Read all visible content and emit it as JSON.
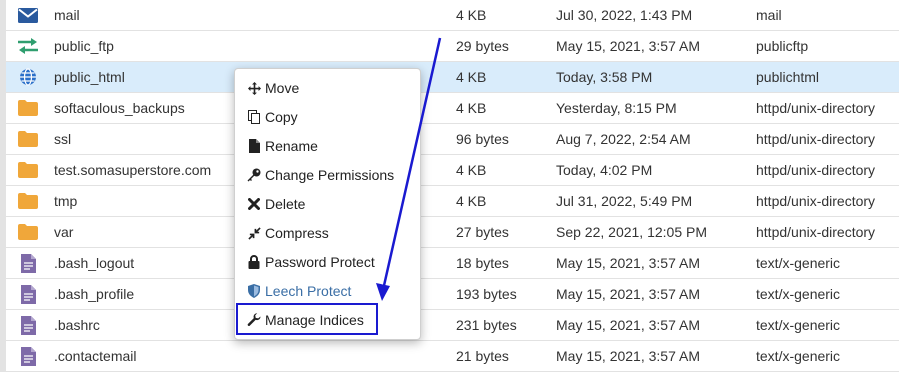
{
  "files": [
    {
      "icon": "mail-icon",
      "name": "mail",
      "size": "4 KB",
      "date": "Jul 30, 2022, 1:43 PM",
      "type": "mail",
      "selected": false
    },
    {
      "icon": "transfer-icon",
      "name": "public_ftp",
      "size": "29 bytes",
      "date": "May 15, 2021, 3:57 AM",
      "type": "publicftp",
      "selected": false
    },
    {
      "icon": "globe-icon",
      "name": "public_html",
      "size": "4 KB",
      "date": "Today, 3:58 PM",
      "type": "publichtml",
      "selected": true
    },
    {
      "icon": "folder-icon",
      "name": "softaculous_backups",
      "size": "4 KB",
      "date": "Yesterday, 8:15 PM",
      "type": "httpd/unix-directory",
      "selected": false
    },
    {
      "icon": "folder-icon",
      "name": "ssl",
      "size": "96 bytes",
      "date": "Aug 7, 2022, 2:54 AM",
      "type": "httpd/unix-directory",
      "selected": false
    },
    {
      "icon": "folder-icon",
      "name": "test.somasuperstore.com",
      "size": "4 KB",
      "date": "Today, 4:02 PM",
      "type": "httpd/unix-directory",
      "selected": false
    },
    {
      "icon": "folder-icon",
      "name": "tmp",
      "size": "4 KB",
      "date": "Jul 31, 2022, 5:49 PM",
      "type": "httpd/unix-directory",
      "selected": false
    },
    {
      "icon": "folder-icon",
      "name": "var",
      "size": "27 bytes",
      "date": "Sep 22, 2021, 12:05 PM",
      "type": "httpd/unix-directory",
      "selected": false
    },
    {
      "icon": "file-icon",
      "name": ".bash_logout",
      "size": "18 bytes",
      "date": "May 15, 2021, 3:57 AM",
      "type": "text/x-generic",
      "selected": false
    },
    {
      "icon": "file-icon",
      "name": ".bash_profile",
      "size": "193 bytes",
      "date": "May 15, 2021, 3:57 AM",
      "type": "text/x-generic",
      "selected": false
    },
    {
      "icon": "file-icon",
      "name": ".bashrc",
      "size": "231 bytes",
      "date": "May 15, 2021, 3:57 AM",
      "type": "text/x-generic",
      "selected": false
    },
    {
      "icon": "file-icon",
      "name": ".contactemail",
      "size": "21 bytes",
      "date": "May 15, 2021, 3:57 AM",
      "type": "text/x-generic",
      "selected": false
    }
  ],
  "context_menu": {
    "items": [
      {
        "label": "Move",
        "icon": "move-icon"
      },
      {
        "label": "Copy",
        "icon": "copy-icon"
      },
      {
        "label": "Rename",
        "icon": "rename-icon"
      },
      {
        "label": "Change Permissions",
        "icon": "key-icon"
      },
      {
        "label": "Delete",
        "icon": "delete-icon"
      },
      {
        "label": "Compress",
        "icon": "compress-icon"
      },
      {
        "label": "Password Protect",
        "icon": "lock-icon"
      },
      {
        "label": "Leech Protect",
        "icon": "shield-icon"
      },
      {
        "label": "Manage Indices",
        "icon": "wrench-icon"
      }
    ],
    "highlighted_item": "Manage Indices"
  },
  "colors": {
    "selected_row": "#d9ecfb",
    "folder": "#f0a73a",
    "file": "#7e6aa8",
    "annotation": "#1a1ad0",
    "leech_protect": "#3a6ea5"
  }
}
